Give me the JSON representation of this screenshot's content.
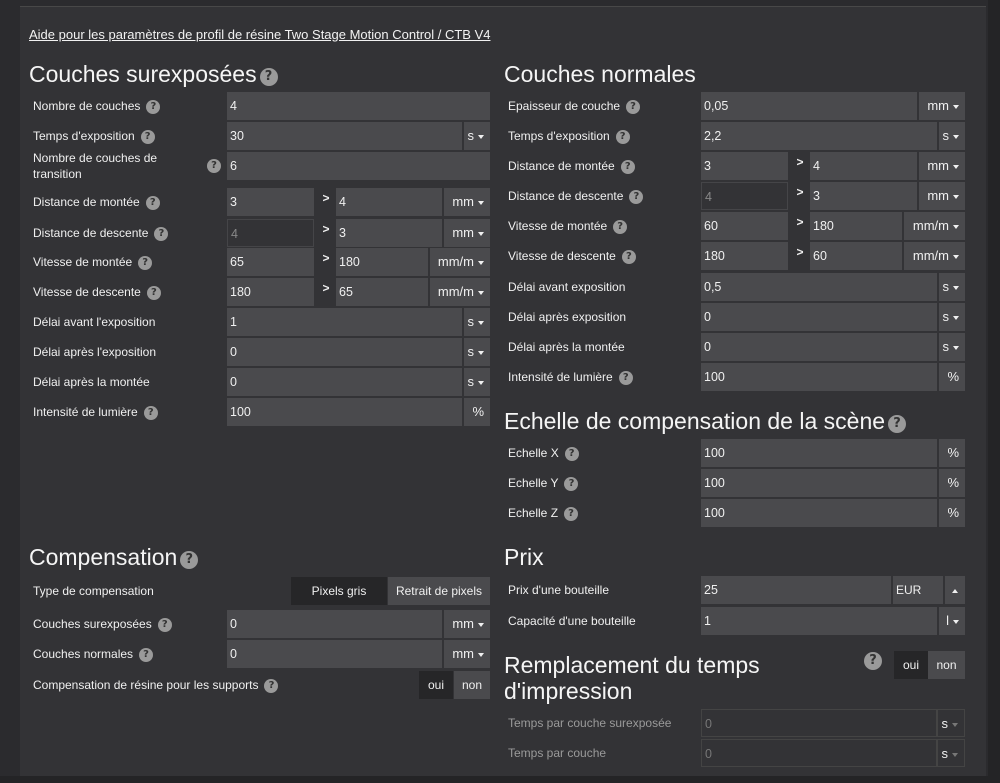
{
  "help_link": "Aide pour les paramètres de profil de résine Two Stage Motion Control / CTB V4",
  "help_glyph": "?",
  "gt": ">",
  "overexposed": {
    "title": "Couches surexposées",
    "rows": {
      "count": {
        "label": "Nombre de couches",
        "value": "4"
      },
      "exposure": {
        "label": "Temps d'exposition",
        "value": "30",
        "unit": "s"
      },
      "transition": {
        "label": "Nombre de couches de transition",
        "value": "6"
      },
      "lift_dist": {
        "label": "Distance de montée",
        "value1": "3",
        "value2": "4",
        "unit": "mm"
      },
      "retract_dist": {
        "label": "Distance de descente",
        "value1": "4",
        "value2": "3",
        "unit": "mm"
      },
      "lift_speed": {
        "label": "Vitesse de montée",
        "value1": "65",
        "value2": "180",
        "unit": "mm/m"
      },
      "retract_speed": {
        "label": "Vitesse de descente",
        "value1": "180",
        "value2": "65",
        "unit": "mm/m"
      },
      "delay_before": {
        "label": "Délai avant l'exposition",
        "value": "1",
        "unit": "s"
      },
      "delay_after": {
        "label": "Délai après l'exposition",
        "value": "0",
        "unit": "s"
      },
      "delay_lift": {
        "label": "Délai après la montée",
        "value": "0",
        "unit": "s"
      },
      "light": {
        "label": "Intensité de lumière",
        "value": "100",
        "unit": "%"
      }
    }
  },
  "normal": {
    "title": "Couches normales",
    "rows": {
      "thickness": {
        "label": "Epaisseur de couche",
        "value": "0,05",
        "unit": "mm"
      },
      "exposure": {
        "label": "Temps d'exposition",
        "value": "2,2",
        "unit": "s"
      },
      "lift_dist": {
        "label": "Distance de montée",
        "value1": "3",
        "value2": "4",
        "unit": "mm"
      },
      "retract_dist": {
        "label": "Distance de descente",
        "value1": "4",
        "value2": "3",
        "unit": "mm"
      },
      "lift_speed": {
        "label": "Vitesse de montée",
        "value1": "60",
        "value2": "180",
        "unit": "mm/m"
      },
      "retract_speed": {
        "label": "Vitesse de descente",
        "value1": "180",
        "value2": "60",
        "unit": "mm/m"
      },
      "delay_before": {
        "label": "Délai avant exposition",
        "value": "0,5",
        "unit": "s"
      },
      "delay_after": {
        "label": "Délai après exposition",
        "value": "0",
        "unit": "s"
      },
      "delay_lift": {
        "label": "Délai après la montée",
        "value": "0",
        "unit": "s"
      },
      "light": {
        "label": "Intensité de lumière",
        "value": "100",
        "unit": "%"
      }
    }
  },
  "scale": {
    "title": "Echelle de compensation de la scène",
    "rows": {
      "x": {
        "label": "Echelle X",
        "value": "100",
        "unit": "%"
      },
      "y": {
        "label": "Echelle Y",
        "value": "100",
        "unit": "%"
      },
      "z": {
        "label": "Echelle Z",
        "value": "100",
        "unit": "%"
      }
    }
  },
  "compensation": {
    "title": "Compensation",
    "type_label": "Type de compensation",
    "opt_gray": "Pixels gris",
    "opt_shrink": "Retrait de pixels",
    "over_label": "Couches surexposées",
    "over_value": "0",
    "over_unit": "mm",
    "normal_label": "Couches normales",
    "normal_value": "0",
    "normal_unit": "mm",
    "support_label": "Compensation de résine pour les supports",
    "yes": "oui",
    "no": "non"
  },
  "price": {
    "title": "Prix",
    "bottle_price_label": "Prix d'une bouteille",
    "bottle_price_value": "25",
    "currency": "EUR",
    "bottle_capacity_label": "Capacité d'une bouteille",
    "bottle_capacity_value": "1",
    "capacity_unit": "l"
  },
  "replace": {
    "title": "Remplacement du temps d'impression",
    "yes": "oui",
    "no": "non",
    "over_label": "Temps par couche surexposée",
    "over_value": "0",
    "over_unit": "s",
    "layer_label": "Temps par couche",
    "layer_value": "0",
    "layer_unit": "s"
  }
}
